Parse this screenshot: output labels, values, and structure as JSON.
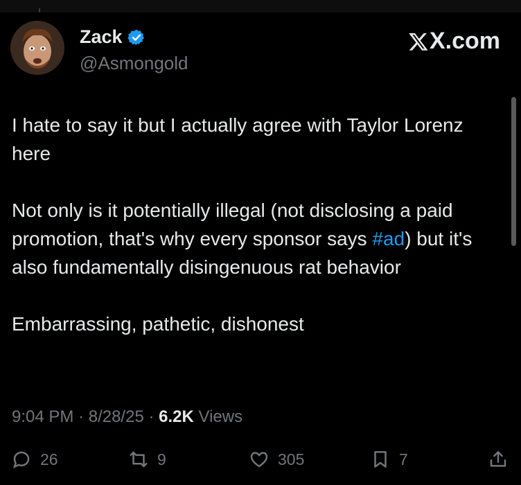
{
  "author": {
    "name": "Zack",
    "handle": "@Asmongold",
    "verified_color": "#1d9bf0",
    "avatar_icon": "avatar-photo"
  },
  "brand": {
    "label": "X.com",
    "icon": "x-logo-icon"
  },
  "tweet": {
    "para1": "I hate to say it but I actually agree with Taylor Lorenz here",
    "para2_before": "Not only is it potentially illegal (not disclosing a paid promotion, that's why every sponsor says ",
    "para2_hashtag": "#ad",
    "para2_after": ") but it's also fundamentally disingenuous rat behavior",
    "para3": "Embarrassing, pathetic, dishonest"
  },
  "meta": {
    "time": "9:04 PM",
    "sep1": " · ",
    "date": "8/28/25",
    "sep2": " · ",
    "views_count": "6.2K",
    "views_label": " Views"
  },
  "actions": {
    "replies": "26",
    "reposts": "9",
    "likes": "305",
    "bookmarks": "7"
  },
  "colors": {
    "background": "#000000",
    "text": "#e7e9ea",
    "secondary": "#71767b",
    "link": "#1d9bf0"
  }
}
